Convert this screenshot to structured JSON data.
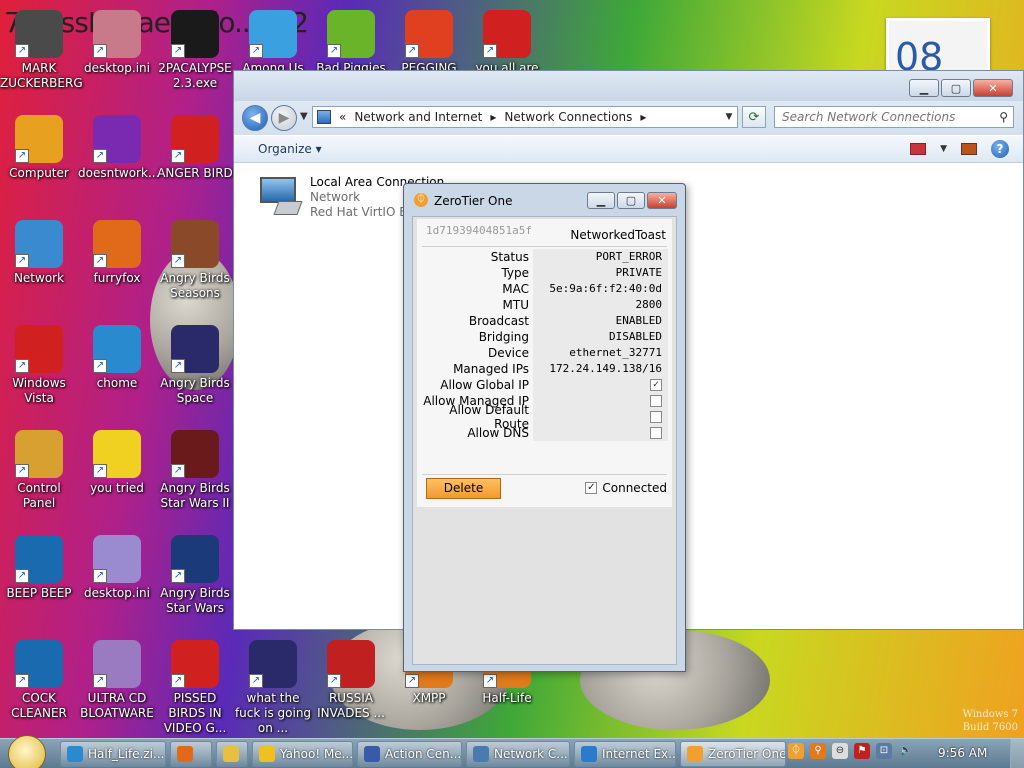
{
  "desktop": {
    "background_title": "7...ossKanae ...tio...012",
    "photo_widget_text": "08",
    "watermark_line1": "Windows 7",
    "watermark_line2": "Build 7600",
    "icons": [
      {
        "label": "MARK ZUCKERBERG",
        "icon": "person-icon",
        "color": "#4a4a4a"
      },
      {
        "label": "desktop.ini",
        "icon": "ini-file-icon",
        "color": "#c87a8a"
      },
      {
        "label": "2PACALYPSE 2.3.exe",
        "icon": "console-app-icon",
        "color": "#1a1a1a"
      },
      {
        "label": "Among Us",
        "icon": "among-us-icon",
        "color": "#3aa0e0"
      },
      {
        "label": "Bad Piggies",
        "icon": "bad-piggies-icon",
        "color": "#6ab42a"
      },
      {
        "label": "PEGGING",
        "icon": "peggle-icon",
        "color": "#e04020"
      },
      {
        "label": "you all are",
        "icon": "dev-cpp-icon",
        "color": "#d02020"
      },
      {
        "label": "Computer",
        "icon": "computer-icon",
        "color": "#e8a020"
      },
      {
        "label": "doesntwork...",
        "icon": "yahoo-messenger-icon",
        "color": "#7a2ab0"
      },
      {
        "label": "ANGER BIRD",
        "icon": "angry-birds-icon",
        "color": "#d02020"
      },
      {
        "label": "Network",
        "icon": "network-globe-icon",
        "color": "#3a8ad0"
      },
      {
        "label": "furryfox",
        "icon": "firefox-icon",
        "color": "#e06a1a"
      },
      {
        "label": "Angry Birds Seasons",
        "icon": "angry-birds-seasons-icon",
        "color": "#8a4a2a"
      },
      {
        "label": "Windows Vista",
        "icon": "recycle-bin-icon",
        "color": "#d02020"
      },
      {
        "label": "chome",
        "icon": "chrome-icon",
        "color": "#2a8ad0"
      },
      {
        "label": "Angry Birds Space",
        "icon": "angry-birds-space-icon",
        "color": "#2a2a6a"
      },
      {
        "label": "Control Panel",
        "icon": "control-panel-icon",
        "color": "#d8a030"
      },
      {
        "label": "you tried",
        "icon": "star-icon",
        "color": "#f0d020"
      },
      {
        "label": "Angry Birds Star Wars II",
        "icon": "angry-birds-star-wars-2-icon",
        "color": "#6a1a1a"
      },
      {
        "label": "BEEP BEEP",
        "icon": "blue-book-icon",
        "color": "#1a6ab0"
      },
      {
        "label": "desktop.ini",
        "icon": "ini-file-icon",
        "color": "#9a8ad0"
      },
      {
        "label": "Angry Birds Star Wars",
        "icon": "angry-birds-star-wars-icon",
        "color": "#1a3a7a"
      },
      {
        "label": "COCK CLEANER",
        "icon": "blue-book-icon",
        "color": "#1a6ab0"
      },
      {
        "label": "ULTRA CD BLOATWARE",
        "icon": "cd-disc-icon",
        "color": "#9a7ac0"
      },
      {
        "label": "PISSED BIRDS IN VIDEO G...",
        "icon": "angry-birds-icon",
        "color": "#d02020"
      },
      {
        "label": "what the fuck is going on ...",
        "icon": "angry-birds-space-icon",
        "color": "#2a2a6a"
      },
      {
        "label": "RUSSIA INVADES ...",
        "icon": "radiation-icon",
        "color": "#c02020"
      },
      {
        "label": "XMPP",
        "icon": "xmpp-icon",
        "color": "#e07a1a"
      },
      {
        "label": "Half-Life",
        "icon": "half-life-icon",
        "color": "#e07a1a"
      }
    ]
  },
  "explorer": {
    "breadcrumb_prefix": "«",
    "breadcrumb": [
      "Network and Internet",
      "Network Connections"
    ],
    "search_placeholder": "Search Network Connections",
    "organize_label": "Organize",
    "item": {
      "name": "Local Area Connection",
      "status": "Network",
      "device": "Red Hat VirtIO Eth"
    }
  },
  "zerotier": {
    "title": "ZeroTier One",
    "network_id": "1d71939404851a5f",
    "network_name": "NetworkedToast",
    "rows": {
      "status": {
        "label": "Status",
        "value": "PORT_ERROR"
      },
      "type": {
        "label": "Type",
        "value": "PRIVATE"
      },
      "mac": {
        "label": "MAC",
        "value": "5e:9a:6f:f2:40:0d"
      },
      "mtu": {
        "label": "MTU",
        "value": "2800"
      },
      "broadcast": {
        "label": "Broadcast",
        "value": "ENABLED"
      },
      "bridging": {
        "label": "Bridging",
        "value": "DISABLED"
      },
      "device": {
        "label": "Device",
        "value": "ethernet_32771"
      },
      "managed_ips": {
        "label": "Managed IPs",
        "value": "172.24.149.138/16"
      }
    },
    "checkboxes": {
      "allow_global_ip": {
        "label": "Allow Global IP",
        "checked": true
      },
      "allow_managed_ip": {
        "label": "Allow Managed IP",
        "checked": false
      },
      "allow_default_route": {
        "label": "Allow Default Route",
        "checked": false
      },
      "allow_dns": {
        "label": "Allow DNS",
        "checked": false
      }
    },
    "check_mark": "✓",
    "delete_label": "Delete",
    "connected_label": "Connected",
    "connected_checked": true,
    "accent_color": "#f0a030"
  },
  "taskbar": {
    "buttons": [
      {
        "label": "Half_Life.zi...",
        "icon": "chrome-icon"
      },
      {
        "label": "",
        "icon": "firefox-icon"
      },
      {
        "label": "",
        "icon": "folder-icon"
      },
      {
        "label": "Yahoo! Me...",
        "icon": "yahoo-messenger-icon"
      },
      {
        "label": "Action Cen...",
        "icon": "action-center-flag-icon"
      },
      {
        "label": "Network C...",
        "icon": "network-connections-icon"
      },
      {
        "label": "Internet Ex...",
        "icon": "internet-explorer-icon"
      },
      {
        "label": "ZeroTier One",
        "icon": "zerotier-icon"
      }
    ],
    "clock": "9:56 AM"
  }
}
